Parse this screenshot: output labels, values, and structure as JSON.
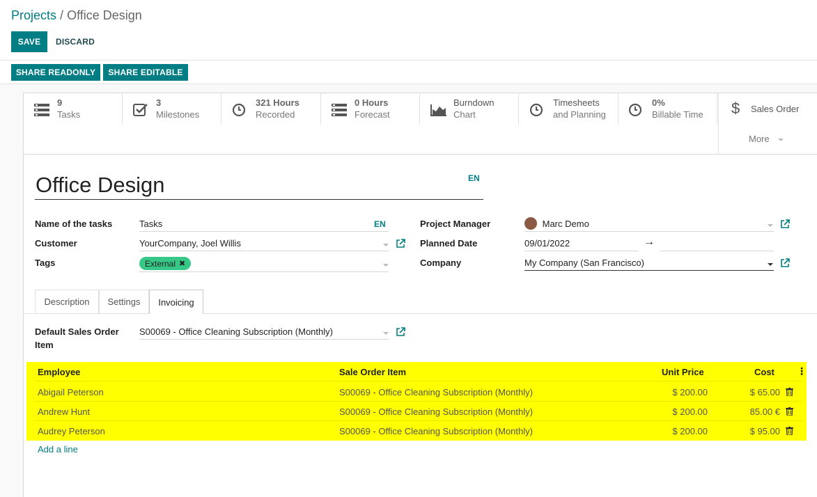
{
  "breadcrumb": {
    "parent": "Projects",
    "separator": "/",
    "current": "Office Design"
  },
  "toolbar": {
    "save_label": "SAVE",
    "discard_label": "DISCARD"
  },
  "share": {
    "readonly_label": "SHARE READONLY",
    "editable_label": "SHARE EDITABLE"
  },
  "smart_buttons": [
    {
      "icon": "tasks-list-icon",
      "line1": "9",
      "line2": "Tasks"
    },
    {
      "icon": "checkbox-icon",
      "line1": "3",
      "line2": "Milestones"
    },
    {
      "icon": "clock-icon",
      "line1": "321 Hours",
      "line2": "Recorded"
    },
    {
      "icon": "tasks-list-icon",
      "line1": "0 Hours",
      "line2": "Forecast"
    },
    {
      "icon": "area-chart-icon",
      "line1": "Burndown",
      "line2": "Chart"
    },
    {
      "icon": "clock-icon",
      "line1": "Timesheets",
      "line2": "and Planning"
    },
    {
      "icon": "clock-icon",
      "line1": "0%",
      "line2": "Billable Time"
    }
  ],
  "sales_order": {
    "label": "Sales Order",
    "icon": "dollar-icon",
    "more_label": "More"
  },
  "record": {
    "name": "Office Design",
    "lang": "EN"
  },
  "fields": {
    "name_tasks_label": "Name of the tasks",
    "name_tasks_value": "Tasks",
    "name_tasks_lang": "EN",
    "customer_label": "Customer",
    "customer_value": "YourCompany, Joel Willis",
    "tags_label": "Tags",
    "tag_value": "External",
    "pm_label": "Project Manager",
    "pm_value": "Marc Demo",
    "planned_label": "Planned Date",
    "planned_start": "09/01/2022",
    "planned_arrow": "→",
    "planned_end": "",
    "company_label": "Company",
    "company_value": "My Company (San Francisco)"
  },
  "tabs": [
    "Description",
    "Settings",
    "Invoicing"
  ],
  "active_tab": "Invoicing",
  "invoicing": {
    "default_so_label_1": "Default Sales Order",
    "default_so_label_2": "Item",
    "default_so_value": "S00069 - Office Cleaning Subscription (Monthly)"
  },
  "table": {
    "headers": {
      "employee": "Employee",
      "so_item": "Sale Order Item",
      "unit_price": "Unit Price",
      "cost": "Cost"
    },
    "rows": [
      {
        "employee": "Abigail Peterson",
        "so_item": "S00069 - Office Cleaning Subscription (Monthly)",
        "unit_price": "$ 200.00",
        "cost": "$ 65.00"
      },
      {
        "employee": "Andrew Hunt",
        "so_item": "S00069 - Office Cleaning Subscription (Monthly)",
        "unit_price": "$ 200.00",
        "cost": "85.00 €"
      },
      {
        "employee": "Audrey Peterson",
        "so_item": "S00069 - Office Cleaning Subscription (Monthly)",
        "unit_price": "$ 200.00",
        "cost": "$ 95.00"
      }
    ],
    "add_line_label": "Add a line"
  },
  "colors": {
    "primary": "#017e84",
    "highlight": "#ffff00",
    "tag": "#35c887"
  }
}
